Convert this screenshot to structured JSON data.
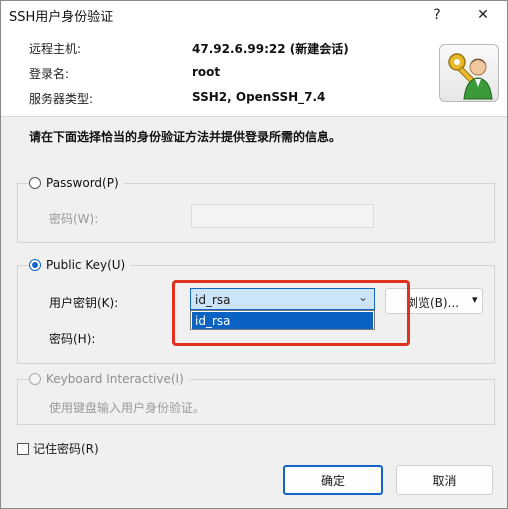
{
  "window": {
    "title": "SSH用户身份验证",
    "help_label": "?",
    "close_label": "✕"
  },
  "info": {
    "remote_host_label": "远程主机:",
    "remote_host_value": "47.92.6.99:22 (新建会话)",
    "login_name_label": "登录名:",
    "login_name_value": "root",
    "server_type_label": "服务器类型:",
    "server_type_value": "SSH2, OpenSSH_7.4",
    "avatar_icon": "user-key-icon"
  },
  "instruction": "请在下面选择恰当的身份验证方法并提供登录所需的信息。",
  "password_group": {
    "radio_label": "Password(P)",
    "password_label": "密码(W):",
    "selected": false
  },
  "public_key_group": {
    "radio_label": "Public Key(U)",
    "selected": true,
    "user_key_label": "用户密钥(K):",
    "user_key_value": "id_rsa",
    "dropdown_options": [
      "id_rsa"
    ],
    "passphrase_label": "密码(H):",
    "browse_label": "浏览(B)..."
  },
  "keyboard_group": {
    "radio_label": "Keyboard Interactive(I)",
    "description": "使用键盘输入用户身份验证。",
    "enabled": false
  },
  "remember_password": {
    "label": "记住密码(R)",
    "checked": false
  },
  "buttons": {
    "ok": "确定",
    "cancel": "取消"
  },
  "colors": {
    "accent": "#1463c8",
    "highlight": "#0a62c2",
    "annotation": "#e0301e"
  }
}
